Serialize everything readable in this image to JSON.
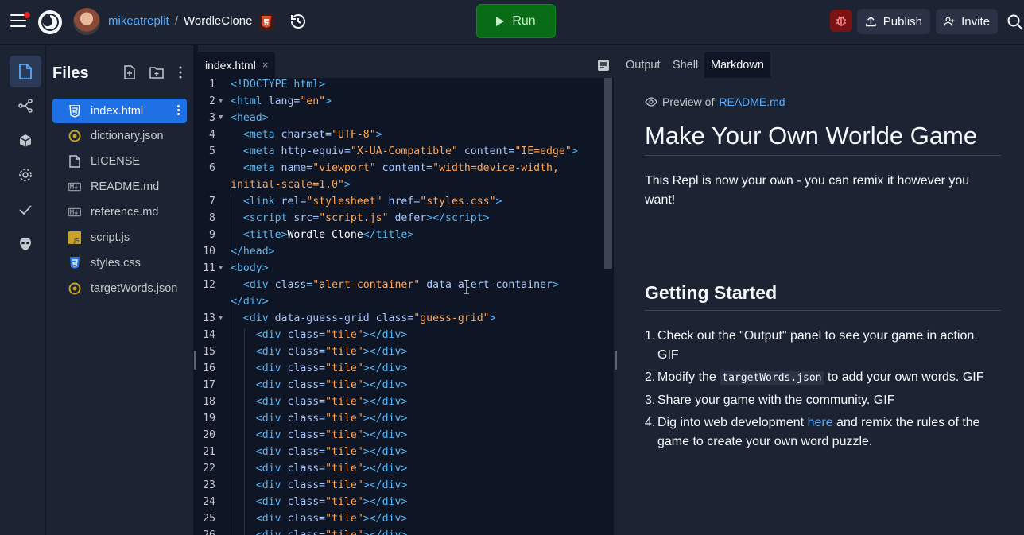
{
  "topbar": {
    "username": "mikeatreplit",
    "separator": "/",
    "repl_name": "WordleClone",
    "run_label": "Run",
    "publish_label": "Publish",
    "invite_label": "Invite"
  },
  "sidebar": {
    "title": "Files",
    "files": [
      {
        "name": "index.html",
        "icon": "html5-icon",
        "active": true
      },
      {
        "name": "dictionary.json",
        "icon": "json-icon"
      },
      {
        "name": "LICENSE",
        "icon": "file-icon"
      },
      {
        "name": "README.md",
        "icon": "markdown-icon"
      },
      {
        "name": "reference.md",
        "icon": "markdown-icon"
      },
      {
        "name": "script.js",
        "icon": "js-icon"
      },
      {
        "name": "styles.css",
        "icon": "css3-icon"
      },
      {
        "name": "targetWords.json",
        "icon": "json-icon"
      }
    ]
  },
  "editor": {
    "tab_label": "index.html",
    "tab_close": "×"
  },
  "right_panel": {
    "tabs": [
      "Output",
      "Shell",
      "Markdown"
    ],
    "active_tab": "Markdown",
    "preview_prefix": "Preview of",
    "preview_file": "README.md",
    "h1": "Make Your Own Worlde Game",
    "intro": "This Repl is now your own - you can remix it however you want!",
    "h2": "Getting Started",
    "steps": [
      {
        "n": "1.",
        "text": "Check out the \"Output\" panel to see your game in action. GIF"
      },
      {
        "n": "2.",
        "pre": "Modify the ",
        "code": "targetWords.json",
        "post": " to add your own words. GIF"
      },
      {
        "n": "3.",
        "text": "Share your game with the community. GIF"
      },
      {
        "n": "4.",
        "pre": "Dig into web development ",
        "link": "here",
        "post": " and remix the rules of the game to create your own word puzzle."
      }
    ]
  },
  "colors": {
    "bg": "#0e1525",
    "panel": "#1c2333",
    "accent": "#1f6fe5",
    "run_green": "#0a6b16",
    "link": "#57abff"
  }
}
